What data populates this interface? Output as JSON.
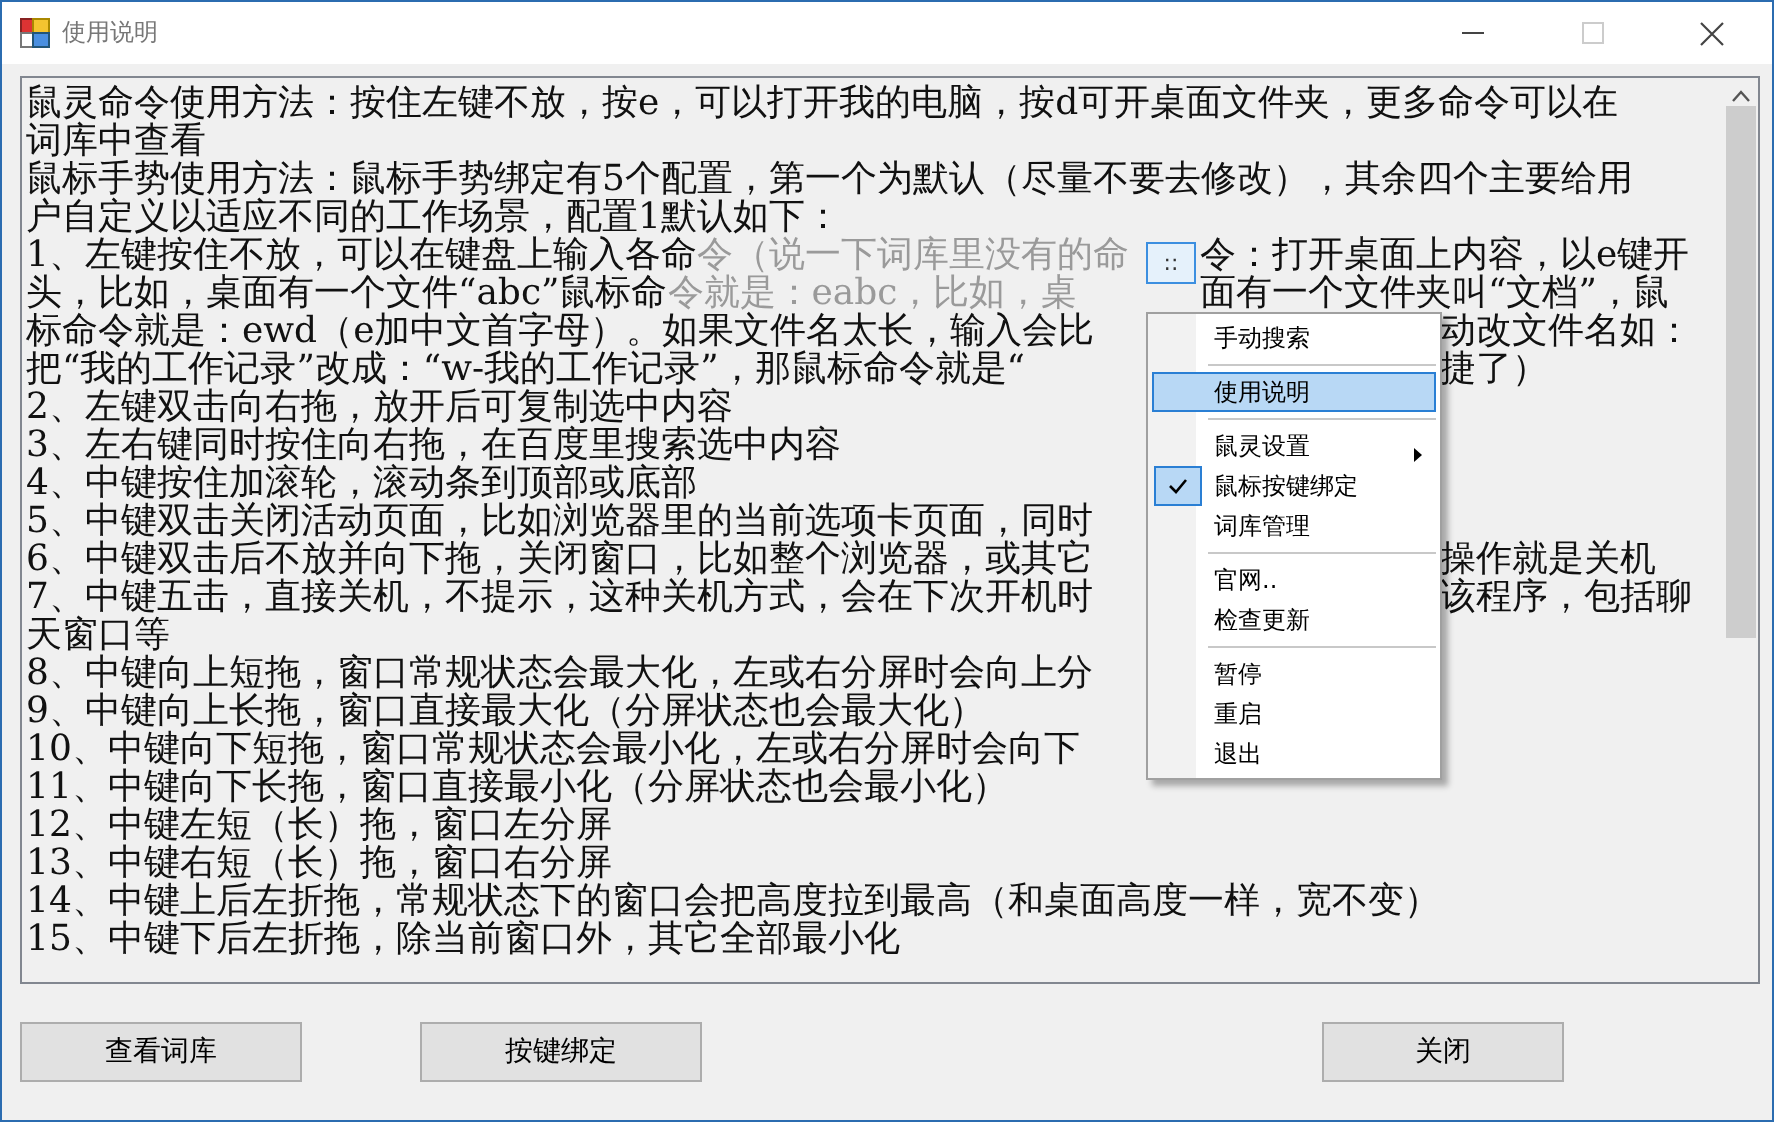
{
  "window": {
    "title": "使用说明"
  },
  "help_text": {
    "lines": [
      {
        "segments": [
          {
            "kind": "text",
            "text": "鼠灵命令使用方法：按住左键不放，按e，可以打开我的电脑，按d可开桌面文件夹，更多命令可以在"
          }
        ]
      },
      {
        "segments": [
          {
            "kind": "text",
            "text": "词库中查看"
          }
        ]
      },
      {
        "segments": [
          {
            "kind": "text",
            "text": "鼠标手势使用方法：鼠标手势绑定有5个配置，第一个为默认（尽量不要去修改），其余四个主要给用"
          }
        ]
      },
      {
        "segments": [
          {
            "kind": "text",
            "text": "户自定义以适应不同的工作场景，配置1默认如下："
          }
        ]
      },
      {
        "segments": [
          {
            "kind": "text",
            "text": "1、左键按住不放，可以在键盘上输入各命"
          },
          {
            "kind": "faded",
            "text": "令（说一下词库里没有的命"
          },
          {
            "kind": "after-button",
            "text": "令：打开桌面上内容，以e键开"
          }
        ]
      },
      {
        "segments": [
          {
            "kind": "text",
            "text": "头，比如，桌面有一个文件“abc”鼠标命"
          },
          {
            "kind": "faded",
            "text": "令就是：eabc，比如，桌"
          },
          {
            "kind": "after-button",
            "text": "面有一个文件夹叫“文档”，鼠"
          }
        ]
      },
      {
        "segments": [
          {
            "kind": "text",
            "text": "标命令就是：ewd（e加中文首字母）。如果文件名太长，输入会比"
          },
          {
            "kind": "after-menu",
            "text": "动改文件名如："
          }
        ]
      },
      {
        "segments": [
          {
            "kind": "text",
            "text": "把“我的工作记录”改成：“w-我的工作记录”，那鼠标命令就是“"
          },
          {
            "kind": "after-menu",
            "text": "捷了）"
          }
        ]
      },
      {
        "segments": [
          {
            "kind": "text",
            "text": "2、左键双击向右拖，放开后可复制选中内容"
          }
        ]
      },
      {
        "segments": [
          {
            "kind": "text",
            "text": "3、左右键同时按住向右拖，在百度里搜索选中内容"
          }
        ]
      },
      {
        "segments": [
          {
            "kind": "text",
            "text": "4、中键按住加滚轮，滚动条到顶部或底部"
          }
        ]
      },
      {
        "segments": [
          {
            "kind": "text",
            "text": "5、中键双击关闭活动页面，比如浏览器里的当前选项卡页面，同时"
          }
        ]
      },
      {
        "segments": [
          {
            "kind": "text",
            "text": "6、中键双击后不放并向下拖，关闭窗口，比如整个浏览器，或其它"
          },
          {
            "kind": "after-menu",
            "text": "操作就是关机"
          }
        ]
      },
      {
        "segments": [
          {
            "kind": "text",
            "text": "7、中键五击，直接关机，不提示，这种关机方式，会在下次开机时"
          },
          {
            "kind": "after-menu",
            "text": "该程序，包括聊"
          }
        ]
      },
      {
        "segments": [
          {
            "kind": "text",
            "text": "天窗口等"
          }
        ]
      },
      {
        "segments": [
          {
            "kind": "text",
            "text": "8、中键向上短拖，窗口常规状态会最大化，左或右分屏时会向上分"
          }
        ]
      },
      {
        "segments": [
          {
            "kind": "text",
            "text": "9、中键向上长拖，窗口直接最大化（分屏状态也会最大化）"
          }
        ]
      },
      {
        "segments": [
          {
            "kind": "text",
            "text": "10、中键向下短拖，窗口常规状态会最小化，左或右分屏时会向下"
          }
        ]
      },
      {
        "segments": [
          {
            "kind": "text",
            "text": "11、中键向下长拖，窗口直接最小化（分屏状态也会最小化）"
          }
        ]
      },
      {
        "segments": [
          {
            "kind": "text",
            "text": "12、中键左短（长）拖，窗口左分屏"
          }
        ]
      },
      {
        "segments": [
          {
            "kind": "text",
            "text": "13、中键右短（长）拖，窗口右分屏"
          }
        ]
      },
      {
        "segments": [
          {
            "kind": "text",
            "text": "14、中键上后左折拖，常规状态下的窗口会把高度拉到最高（和桌面高度一样，宽不变）"
          }
        ]
      },
      {
        "segments": [
          {
            "kind": "text",
            "text": "15、中键下后左折拖，除当前窗口外，其它全部最小化"
          }
        ]
      }
    ]
  },
  "drag_handle": {
    "label": "::"
  },
  "context_menu": {
    "groups": [
      [
        {
          "label": "手动搜索",
          "selected": false,
          "checked": false,
          "submenu": false
        }
      ],
      [
        {
          "label": "使用说明",
          "selected": true,
          "checked": false,
          "submenu": false
        }
      ],
      [
        {
          "label": "鼠灵设置",
          "selected": false,
          "checked": false,
          "submenu": true
        },
        {
          "label": "鼠标按键绑定",
          "selected": false,
          "checked": true,
          "submenu": false
        },
        {
          "label": "词库管理",
          "selected": false,
          "checked": false,
          "submenu": false
        }
      ],
      [
        {
          "label": "官网..",
          "selected": false,
          "checked": false,
          "submenu": false
        },
        {
          "label": "检查更新",
          "selected": false,
          "checked": false,
          "submenu": false
        }
      ],
      [
        {
          "label": "暂停",
          "selected": false,
          "checked": false,
          "submenu": false
        },
        {
          "label": "重启",
          "selected": false,
          "checked": false,
          "submenu": false
        },
        {
          "label": "退出",
          "selected": false,
          "checked": false,
          "submenu": false
        }
      ]
    ]
  },
  "buttons": [
    {
      "label": "查看词库"
    },
    {
      "label": "按键绑定"
    },
    {
      "label": "关闭"
    }
  ]
}
